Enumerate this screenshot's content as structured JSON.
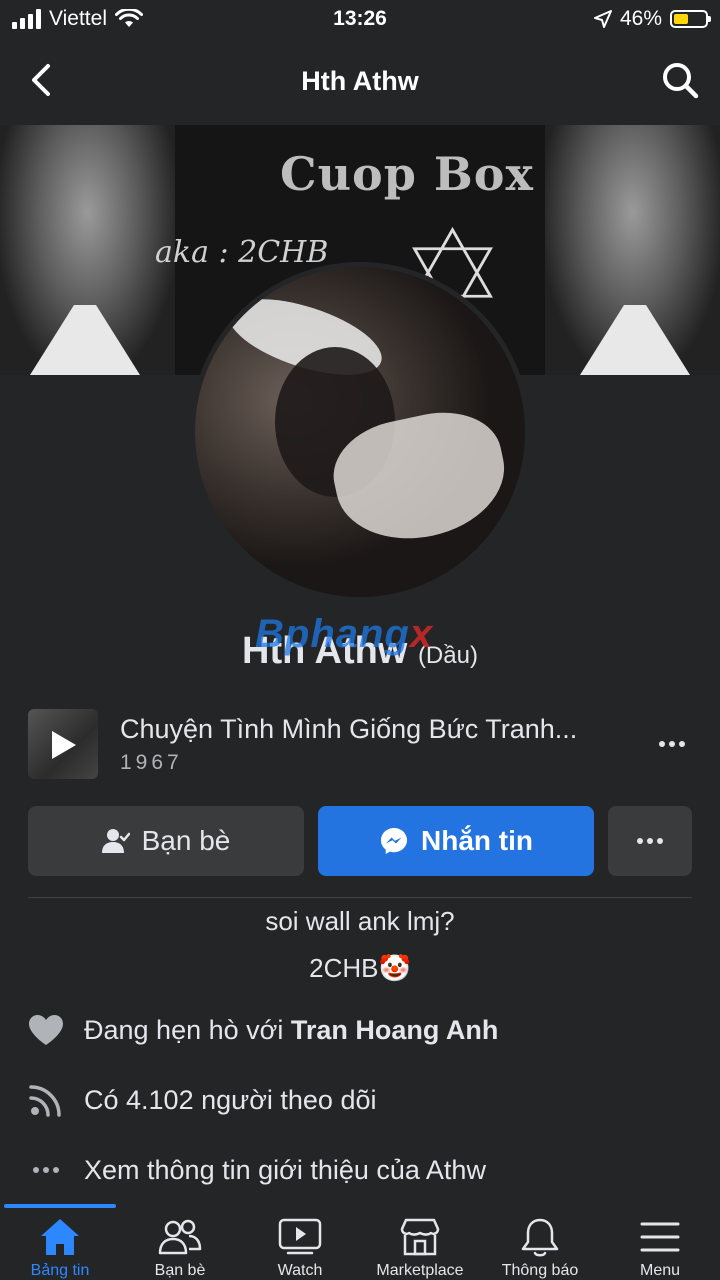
{
  "status": {
    "carrier": "Viettel",
    "time": "13:26",
    "battery": "46%",
    "battery_level": 0.46
  },
  "header": {
    "title": "Hth Athw"
  },
  "cover": {
    "title": "Cuop Box",
    "aka": "aka : 2CHB"
  },
  "profile": {
    "name": "Hth Athw",
    "alt_name": "(Dầu)"
  },
  "watermark": {
    "text": "Bphang",
    "x": "x"
  },
  "music": {
    "song": "Chuyện Tình Mình Giống Bức Tranh...",
    "year": "1967"
  },
  "actions": {
    "friends": "Bạn bè",
    "message": "Nhắn tin"
  },
  "bio": {
    "line1": "soi wall ank lmj?",
    "line2": "2CHB🤡"
  },
  "info": {
    "relationship_prefix": "Đang hẹn hò với ",
    "relationship_name": "Tran Hoang Anh",
    "followers": "Có 4.102 người theo dõi",
    "about": "Xem thông tin giới thiệu của Athw"
  },
  "nav": [
    {
      "label": "Bảng tin",
      "icon": "home-icon",
      "active": true
    },
    {
      "label": "Bạn bè",
      "icon": "friends-icon",
      "active": false
    },
    {
      "label": "Watch",
      "icon": "watch-icon",
      "active": false
    },
    {
      "label": "Marketplace",
      "icon": "marketplace-icon",
      "active": false
    },
    {
      "label": "Thông báo",
      "icon": "bell-icon",
      "active": false
    },
    {
      "label": "Menu",
      "icon": "menu-icon",
      "active": false
    }
  ],
  "colors": {
    "accent": "#2374e1",
    "nav_active": "#2d88ff",
    "background": "#242526",
    "button": "#3a3b3c",
    "battery": "#ffd60a"
  }
}
